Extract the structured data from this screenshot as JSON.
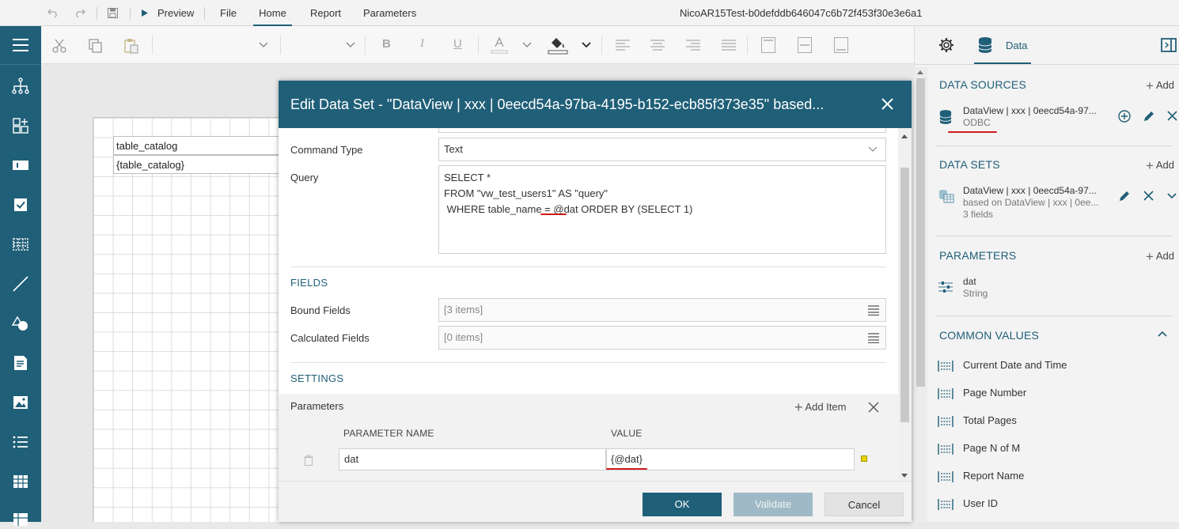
{
  "menubar": {
    "preview": "Preview",
    "file": "File",
    "home": "Home",
    "report": "Report",
    "parameters": "Parameters",
    "doc_title": "NicoAR15Test-b0defddb646047c6b72f453f30e3e6a1"
  },
  "report": {
    "cell1": "table_catalog",
    "cell2": "{table_catalog}"
  },
  "right_panel": {
    "tab_data": "Data",
    "data_sources": {
      "title": "DATA SOURCES",
      "add": "Add",
      "item": {
        "name": "DataView | xxx | 0eecd54a-97...",
        "type": "ODBC"
      }
    },
    "data_sets": {
      "title": "DATA SETS",
      "add": "Add",
      "item": {
        "name": "DataView | xxx | 0eecd54a-97...",
        "based": "based on DataView | xxx | 0ee...",
        "fields": "3 fields"
      }
    },
    "parameters": {
      "title": "PARAMETERS",
      "add": "Add",
      "item": {
        "name": "dat",
        "type": "String"
      }
    },
    "common_values": {
      "title": "COMMON VALUES",
      "items": [
        "Current Date and Time",
        "Page Number",
        "Total Pages",
        "Page N of M",
        "Report Name",
        "User ID"
      ]
    }
  },
  "dialog": {
    "title": "Edit Data Set - \"DataView | xxx | 0eecd54a-97ba-4195-b152-ecb85f373e35\" based...",
    "command_type_label": "Command Type",
    "command_type_value": "Text",
    "query_label": "Query",
    "query_lines": [
      "SELECT *",
      "FROM \"vw_test_users1\" AS \"query\""
    ],
    "query_line3_pre": " WHERE table_name = ",
    "query_line3_param": "@dat",
    "query_line3_post": " ORDER BY (SELECT 1)",
    "fields_section": "FIELDS",
    "bound_fields_label": "Bound Fields",
    "bound_fields_value": "[3 items]",
    "calc_fields_label": "Calculated Fields",
    "calc_fields_value": "[0 items]",
    "settings_section": "SETTINGS",
    "parameters_label": "Parameters",
    "add_item": "Add Item",
    "col_param_name": "PARAMETER NAME",
    "col_value": "VALUE",
    "param_row": {
      "name": "dat",
      "value": "{@dat}"
    },
    "ok": "OK",
    "validate": "Validate",
    "cancel": "Cancel"
  },
  "colors": {
    "brand": "#205f78",
    "annotation": "#d01b1b"
  }
}
